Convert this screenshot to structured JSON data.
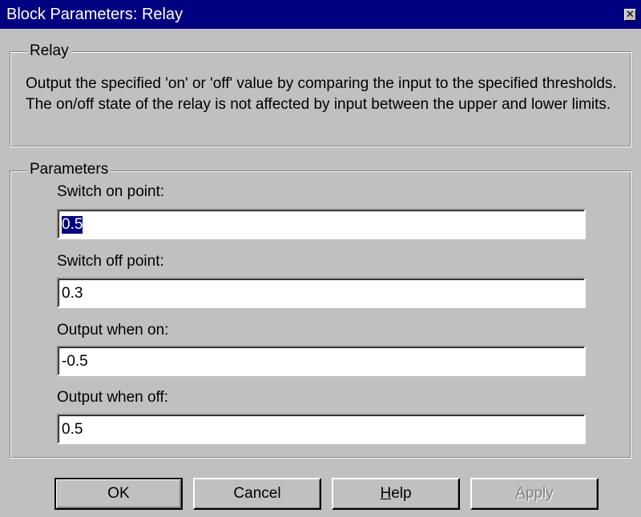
{
  "window": {
    "title": "Block Parameters: Relay",
    "close_glyph": "✕"
  },
  "description_group": {
    "label": "Relay",
    "text": "Output the specified 'on' or 'off' value by comparing the input to the specified thresholds.  The on/off state of the relay is not affected by input between the upper and lower limits."
  },
  "parameters_group": {
    "label": "Parameters",
    "fields": [
      {
        "label": "Switch on point:",
        "value": "0.5",
        "selected": true
      },
      {
        "label": "Switch off point:",
        "value": "0.3",
        "selected": false
      },
      {
        "label": "Output when on:",
        "value": "-0.5",
        "selected": false
      },
      {
        "label": "Output when off:",
        "value": "0.5",
        "selected": false
      }
    ]
  },
  "buttons": {
    "ok": "OK",
    "cancel": "Cancel",
    "help_underlined": "H",
    "help_rest": "elp",
    "apply_underlined": "A",
    "apply_rest": "pply"
  },
  "colors": {
    "titlebar": "#000080",
    "face": "#c0c0c0",
    "selection": "#000080"
  }
}
